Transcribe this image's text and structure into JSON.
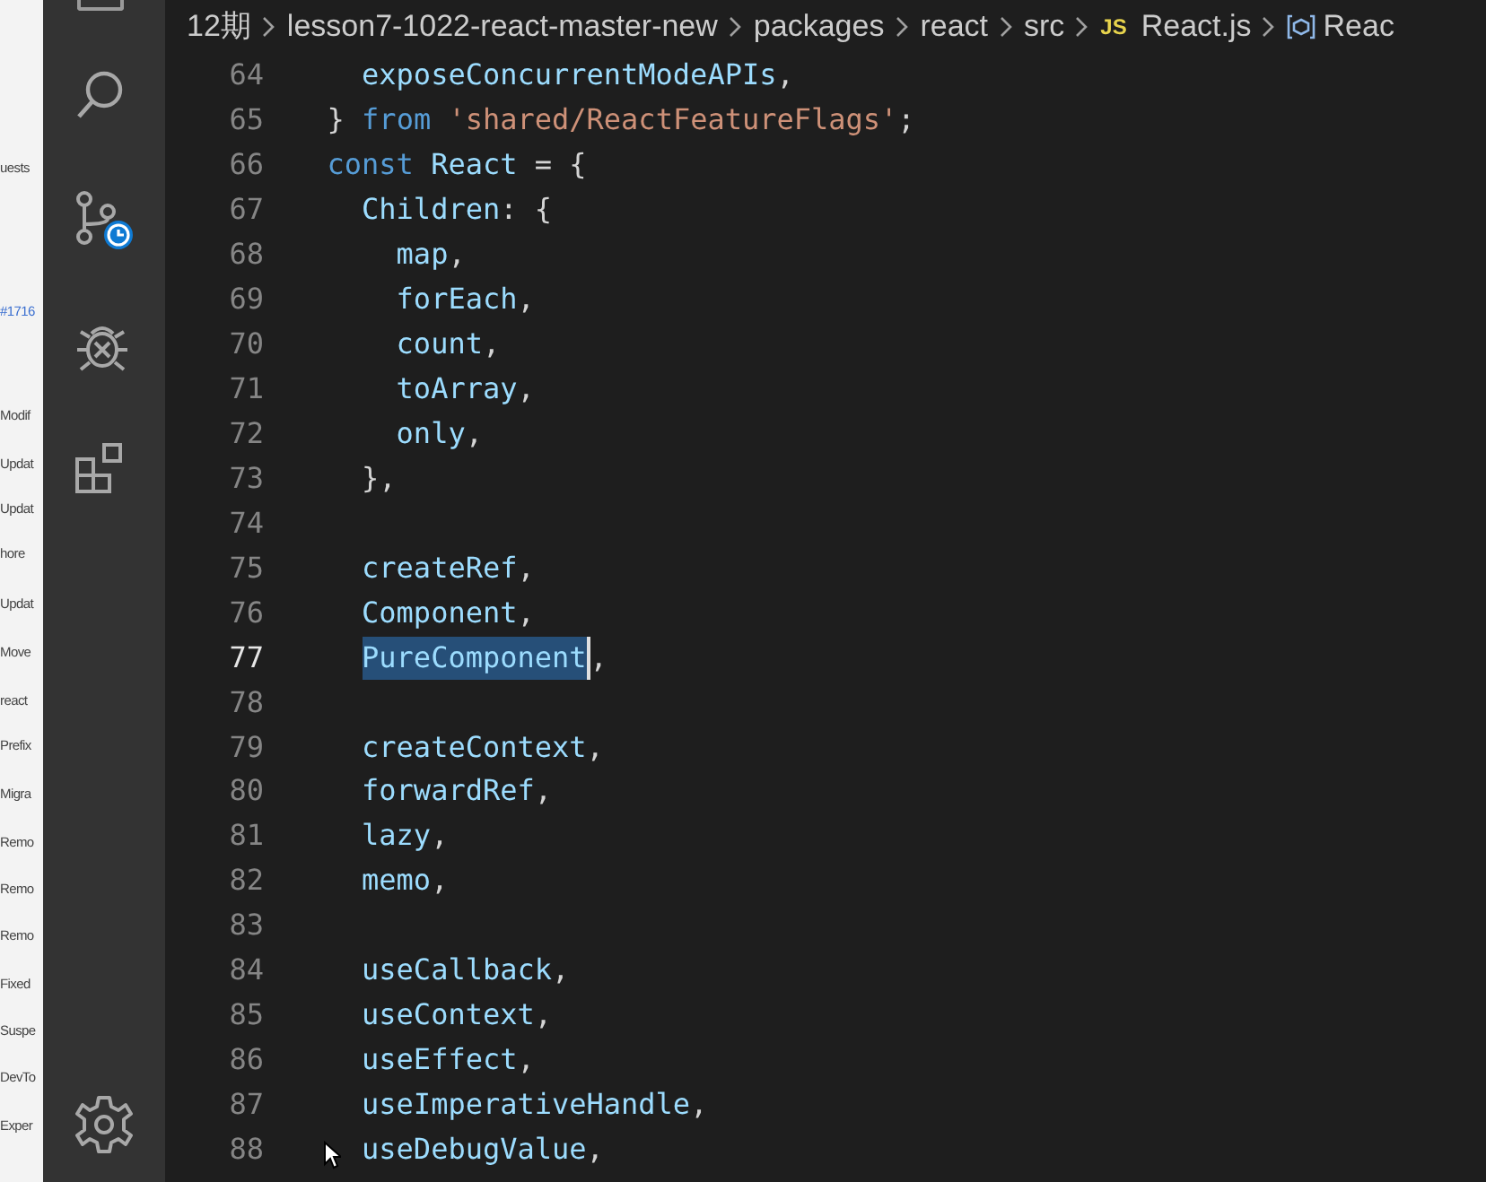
{
  "browser_strip": {
    "items": [
      "uests",
      "#1716",
      "Modif",
      "Updat",
      "Updat",
      "hore",
      "Updat",
      "Move",
      "react",
      "Prefix",
      "Migra",
      "Remo",
      "Remo",
      "Remo",
      "Fixed",
      "Suspe",
      "DevTo",
      "Exper"
    ]
  },
  "activity_bar": {
    "items": [
      {
        "kind": "search",
        "selected": false
      },
      {
        "kind": "source-control",
        "selected": false
      },
      {
        "kind": "debug",
        "selected": false
      },
      {
        "kind": "extensions",
        "selected": false
      }
    ]
  },
  "breadcrumb": [
    {
      "kind": "folder",
      "label": "12期"
    },
    {
      "kind": "folder",
      "label": "lesson7-1022-react-master-new"
    },
    {
      "kind": "folder",
      "label": "packages"
    },
    {
      "kind": "folder",
      "label": "react"
    },
    {
      "kind": "folder",
      "label": "src"
    },
    {
      "kind": "file",
      "badge": "JS",
      "label": "React.js"
    },
    {
      "kind": "symbol",
      "label": "Reac"
    }
  ],
  "editor": {
    "lines": [
      {
        "number": "64",
        "selected": false,
        "tokens": [
          {
            "text": "    exposeConcurrentModeAPIs",
            "kind": "ident"
          },
          {
            "text": ",",
            "kind": "punct"
          }
        ]
      },
      {
        "number": "65",
        "selected": false,
        "tokens": [
          {
            "text": "  } ",
            "kind": "punct"
          },
          {
            "text": "from",
            "kind": "keyword"
          },
          {
            "text": " 'shared/ReactFeatureFlags'",
            "kind": "string"
          },
          {
            "text": ";",
            "kind": "punct"
          }
        ]
      },
      {
        "number": "66",
        "selected": false,
        "tokens": [
          {
            "text": "  const",
            "kind": "keyword"
          },
          {
            "text": " React ",
            "kind": "ident"
          },
          {
            "text": "= {",
            "kind": "punct"
          }
        ]
      },
      {
        "number": "67",
        "selected": false,
        "tokens": [
          {
            "text": "    Children",
            "kind": "ident"
          },
          {
            "text": ": {",
            "kind": "punct"
          }
        ]
      },
      {
        "number": "68",
        "selected": false,
        "tokens": [
          {
            "text": "      map",
            "kind": "ident"
          },
          {
            "text": ",",
            "kind": "punct"
          }
        ]
      },
      {
        "number": "69",
        "selected": false,
        "tokens": [
          {
            "text": "      forEach",
            "kind": "ident"
          },
          {
            "text": ",",
            "kind": "punct"
          }
        ]
      },
      {
        "number": "70",
        "selected": false,
        "tokens": [
          {
            "text": "      count",
            "kind": "ident"
          },
          {
            "text": ",",
            "kind": "punct"
          }
        ]
      },
      {
        "number": "71",
        "selected": false,
        "tokens": [
          {
            "text": "      toArray",
            "kind": "ident"
          },
          {
            "text": ",",
            "kind": "punct"
          }
        ]
      },
      {
        "number": "72",
        "selected": false,
        "tokens": [
          {
            "text": "      only",
            "kind": "ident"
          },
          {
            "text": ",",
            "kind": "punct"
          }
        ]
      },
      {
        "number": "73",
        "selected": false,
        "tokens": [
          {
            "text": "    },",
            "kind": "punct"
          }
        ]
      },
      {
        "number": "74",
        "selected": false
      },
      {
        "number": "75",
        "selected": false,
        "tokens": [
          {
            "text": "    createRef",
            "kind": "ident"
          },
          {
            "text": ",",
            "kind": "punct"
          }
        ]
      },
      {
        "number": "76",
        "selected": false,
        "tokens": [
          {
            "text": "    Component",
            "kind": "ident"
          },
          {
            "text": ",",
            "kind": "punct"
          }
        ]
      },
      {
        "number": "77",
        "selected": true,
        "tokens": [
          {
            "text": "    PureComponent",
            "kind": "selection"
          },
          {
            "text": ",",
            "kind": "punct"
          }
        ]
      },
      {
        "number": "78",
        "selected": false
      },
      {
        "number": "79",
        "selected": false,
        "tokens": [
          {
            "text": "    createContext",
            "kind": "ident"
          },
          {
            "text": ",",
            "kind": "punct"
          }
        ]
      },
      {
        "number": "80",
        "selected": false,
        "tokens": [
          {
            "text": "    forwardRef",
            "kind": "ident"
          },
          {
            "text": ",",
            "kind": "punct"
          }
        ]
      },
      {
        "number": "81",
        "selected": false,
        "tokens": [
          {
            "text": "    lazy",
            "kind": "ident"
          },
          {
            "text": ",",
            "kind": "punct"
          }
        ]
      },
      {
        "number": "82",
        "selected": false,
        "tokens": [
          {
            "text": "    memo",
            "kind": "ident"
          },
          {
            "text": ",",
            "kind": "punct"
          }
        ]
      },
      {
        "number": "83",
        "selected": false
      },
      {
        "number": "84",
        "selected": false,
        "tokens": [
          {
            "text": "    useCallback",
            "kind": "ident"
          },
          {
            "text": ",",
            "kind": "punct"
          }
        ]
      },
      {
        "number": "85",
        "selected": false,
        "tokens": [
          {
            "text": "    useContext",
            "kind": "ident"
          },
          {
            "text": ",",
            "kind": "punct"
          }
        ]
      },
      {
        "number": "86",
        "selected": false,
        "tokens": [
          {
            "text": "    useEffect",
            "kind": "ident"
          },
          {
            "text": ",",
            "kind": "punct"
          }
        ]
      },
      {
        "number": "87",
        "selected": false,
        "tokens": [
          {
            "text": "    useImperativeHandle",
            "kind": "ident"
          },
          {
            "text": ",",
            "kind": "punct"
          }
        ]
      },
      {
        "number": "88",
        "selected": false,
        "tokens": [
          {
            "text": "    useDebugValue",
            "kind": "ident"
          },
          {
            "text": ",",
            "kind": "punct"
          }
        ]
      }
    ]
  }
}
